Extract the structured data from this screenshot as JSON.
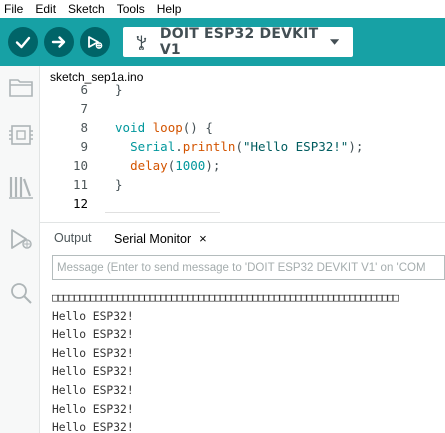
{
  "menu": {
    "items": [
      "File",
      "Edit",
      "Sketch",
      "Tools",
      "Help"
    ]
  },
  "toolbar": {
    "verify_icon": "checkmark-icon",
    "upload_icon": "arrow-right-icon",
    "debug_icon": "debug-icon",
    "board_icon": "usb-icon",
    "board_name": "DOIT ESP32 DEVKIT V1"
  },
  "sidebar": {
    "icons": [
      "folder-icon",
      "boards-manager-icon",
      "library-icon",
      "debug-icon",
      "search-icon"
    ]
  },
  "editor": {
    "file_tab": "sketch_sep1a.ino",
    "lines": [
      {
        "n": "6",
        "text": "}"
      },
      {
        "n": "7",
        "text": ""
      },
      {
        "n": "8",
        "text": "void loop() {"
      },
      {
        "n": "9",
        "text": "  Serial.println(\"Hello ESP32!\");"
      },
      {
        "n": "10",
        "text": "  delay(1000);"
      },
      {
        "n": "11",
        "text": "}"
      },
      {
        "n": "12",
        "text": ""
      }
    ]
  },
  "panel": {
    "tab_output": "Output",
    "tab_serial": "Serial Monitor",
    "close_glyph": "×",
    "message_placeholder": "Message (Enter to send message to 'DOIT ESP32 DEVKIT V1' on 'COM",
    "garbage_line": "□□□□□□□□□□□□□□□□□□□□□□□□□□□□□□□□□□□□□□□□□□□□□□□□□□□□□□□□□□□□□□□□",
    "serial_lines": [
      "Hello ESP32!",
      "Hello ESP32!",
      "Hello ESP32!",
      "Hello ESP32!",
      "Hello ESP32!",
      "Hello ESP32!",
      "Hello ESP32!"
    ]
  },
  "colors": {
    "toolbar_bg": "#17a1a5",
    "button_bg": "#006468",
    "accent": "#00979c"
  }
}
